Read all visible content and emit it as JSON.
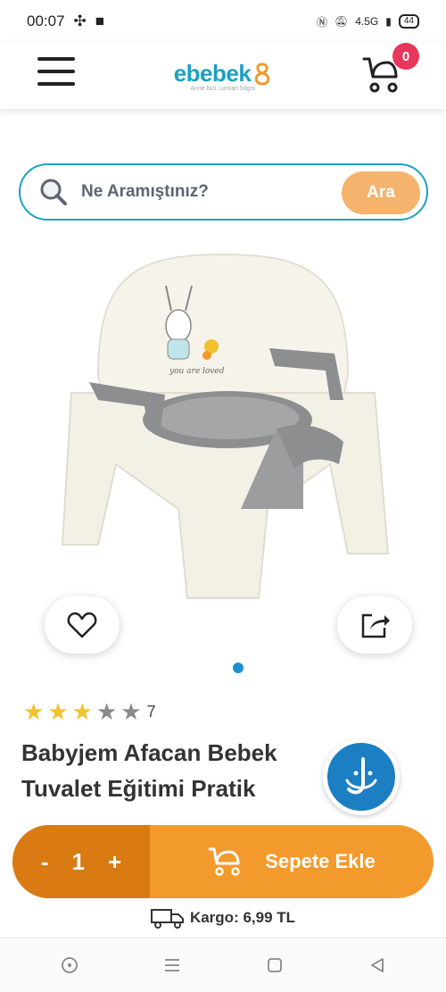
{
  "status": {
    "time": "00:07",
    "battery": "44",
    "signal": "4.5G"
  },
  "header": {
    "logo_text": "ebebek",
    "logo_tagline": "Anne bizi, uzman bilgisi",
    "cart_count": "0"
  },
  "search": {
    "placeholder": "Ne Aramıştınız?",
    "button_label": "Ara"
  },
  "product": {
    "image_caption": "you are loved",
    "rating": {
      "stars_filled": 3,
      "stars_total": 5,
      "count": "7"
    },
    "title_line1": "Babyjem Afacan Bebek",
    "title_line2": "Tuvalet Eğitimi Pratik",
    "gallery": {
      "current": 1,
      "total": 1
    }
  },
  "cart_bar": {
    "minus": "-",
    "quantity": "1",
    "plus": "+",
    "add_label": "Sepete Ekle"
  },
  "shipping": {
    "label": "Kargo: 6,99 TL"
  },
  "colors": {
    "brand": "#1ca0c4",
    "accent": "#f39a2d",
    "accent_dark": "#d97b12",
    "badge": "#e8365d"
  }
}
